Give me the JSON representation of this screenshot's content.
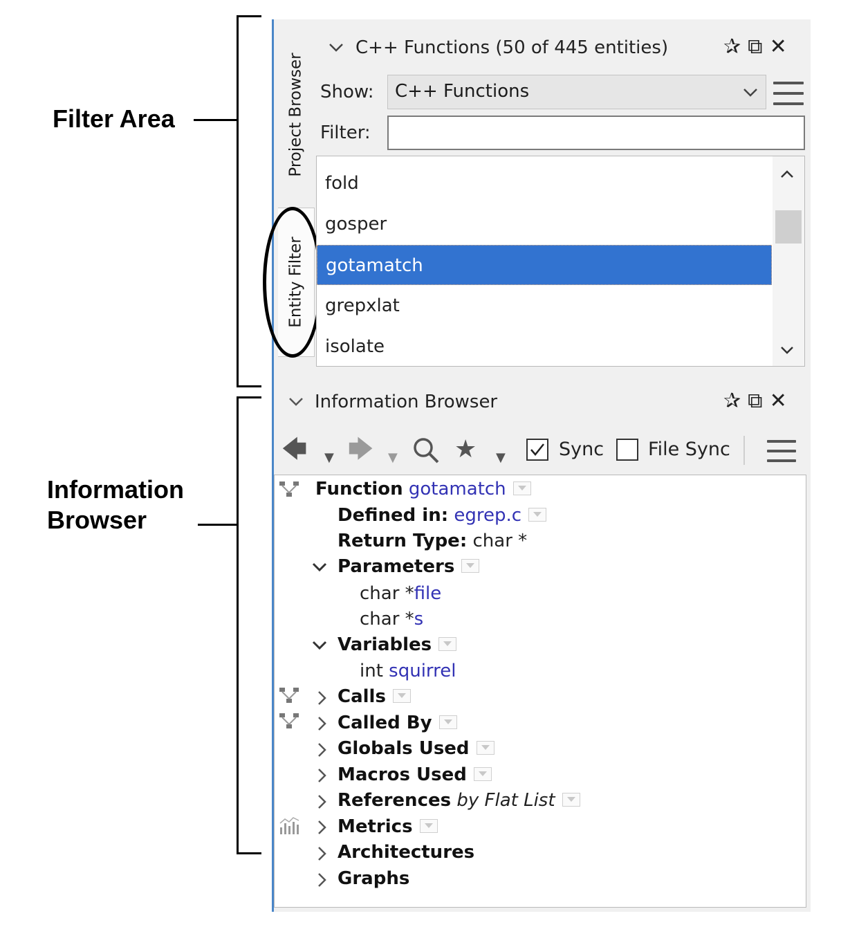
{
  "callouts": {
    "filter_area": "Filter Area",
    "info_browser_line1": "Information",
    "info_browser_line2": "Browser"
  },
  "tabs": {
    "project_browser": "Project Browser",
    "entity_filter": "Entity Filter"
  },
  "filter_panel": {
    "title": "C++ Functions (50 of 445 entities)",
    "show_label": "Show:",
    "show_value": "C++ Functions",
    "filter_label": "Filter:",
    "filter_value": "",
    "items": [
      "fold",
      "gosper",
      "gotamatch",
      "grepxlat",
      "isolate"
    ],
    "selected_index": 2
  },
  "info_panel": {
    "title": "Information Browser",
    "sync_label": "Sync",
    "sync_checked": true,
    "file_sync_label": "File Sync",
    "file_sync_checked": false
  },
  "info": {
    "function_label": "Function",
    "function_name": "gotamatch",
    "defined_in_label": "Defined in:",
    "defined_in_value": "egrep.c",
    "return_type_label": "Return Type:",
    "return_type_value": "char *",
    "parameters_label": "Parameters",
    "param1_type": "char *",
    "param1_name": "file",
    "param2_type": "char *",
    "param2_name": "s",
    "variables_label": "Variables",
    "var1_type": "int",
    "var1_name": "squirrel",
    "calls": "Calls",
    "called_by": "Called By",
    "globals_used": "Globals Used",
    "macros_used": "Macros Used",
    "references": "References",
    "references_mode": "by Flat List",
    "metrics": "Metrics",
    "architectures": "Architectures",
    "graphs": "Graphs"
  },
  "icons": [
    "chevron-down-icon",
    "pin-icon",
    "restore-icon",
    "close-icon",
    "menu-icon",
    "back-arrow-icon",
    "forward-arrow-icon",
    "search-icon",
    "star-icon",
    "graph-icon",
    "metrics-icon"
  ],
  "colors": {
    "selection": "#3273d0",
    "link": "#3232b4",
    "panel_border": "#4a86c8"
  }
}
